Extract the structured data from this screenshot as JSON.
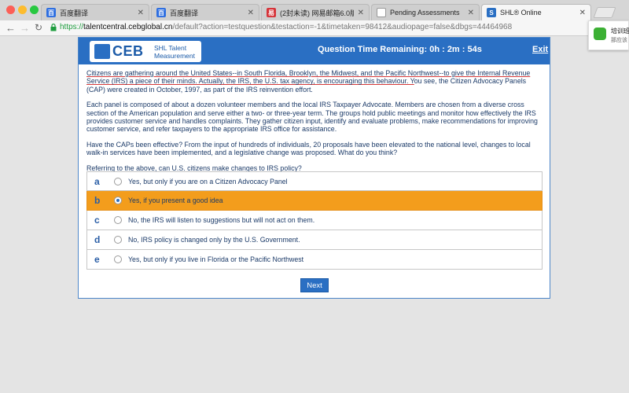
{
  "browser": {
    "tabs": [
      {
        "label": "百度翻译",
        "icon": "baidu-paw-icon",
        "color": "#2f6fe0",
        "active": false
      },
      {
        "label": "百度翻译",
        "icon": "baidu-paw-icon",
        "color": "#2f6fe0",
        "active": false
      },
      {
        "label": "(2封未读) 网易邮箱6.0版",
        "icon": "netease-mail-icon",
        "color": "#d6343a",
        "active": false
      },
      {
        "label": "Pending Assessments",
        "icon": "page-icon",
        "color": "#888888",
        "active": false
      },
      {
        "label": "SHL® Online",
        "icon": "shl-icon",
        "color": "#2a6fc3",
        "active": true
      }
    ],
    "url_prefix": "https://",
    "url_domain": "talentcentral.cebglobal.cn",
    "url_path": "/default?action=testquestion&testaction=-1&timetaken=98412&audiopage=false&dbgs=44464968"
  },
  "notification": {
    "line1": "培训班",
    "line2": "那应该"
  },
  "header": {
    "logo_text": "CEB",
    "logo_sub": "SHL Talent Measurement",
    "timer": "Question Time Remaining: 0h : 2m : 54s",
    "exit_label": "Exit"
  },
  "passage": {
    "p1_underlined": "Citizens are gathering around the United States--in South Florida, Brooklyn, the Midwest, and the Pacific Northwest--to give the Internal Revenue Service (IRS) a piece of their minds. Actually, the IRS, the U.S. tax agency, is encouraging this behaviour. Y",
    "p1_rest": "ou see, the Citizen Advocacy Panels (CAP) were created in October, 1997, as part of the IRS reinvention effort.",
    "p2": "Each panel is composed of about a dozen volunteer members and the local IRS Taxpayer Advocate. Members are chosen from a diverse cross section of the American population and serve either a two- or three-year term. The groups hold public meetings and monitor how effectively the IRS provides customer service and handles complaints. They gather citizen input, identify and evaluate problems, make recommendations for improving customer service, and refer taxpayers to the appropriate IRS office for assistance.",
    "p3": "Have the CAPs been effective? From the input of hundreds of individuals, 20 proposals have been elevated to the national level, changes to local walk-in services have been implemented, and a legislative change was proposed. What do you think?",
    "question": "Referring to the above, can U.S. citizens make changes to IRS policy?"
  },
  "options": [
    {
      "letter": "a",
      "text": "Yes, but only if you are on a Citizen Advocacy Panel",
      "selected": false
    },
    {
      "letter": "b",
      "text": "Yes, if you present a good idea",
      "selected": true
    },
    {
      "letter": "c",
      "text": "No, the IRS will listen to suggestions but will not act on them.",
      "selected": false
    },
    {
      "letter": "d",
      "text": "No, IRS policy is changed only by the U.S. Government.",
      "selected": false
    },
    {
      "letter": "e",
      "text": "Yes, but only if you live in Florida or the Pacific Northwest",
      "selected": false
    }
  ],
  "next_label": "Next"
}
